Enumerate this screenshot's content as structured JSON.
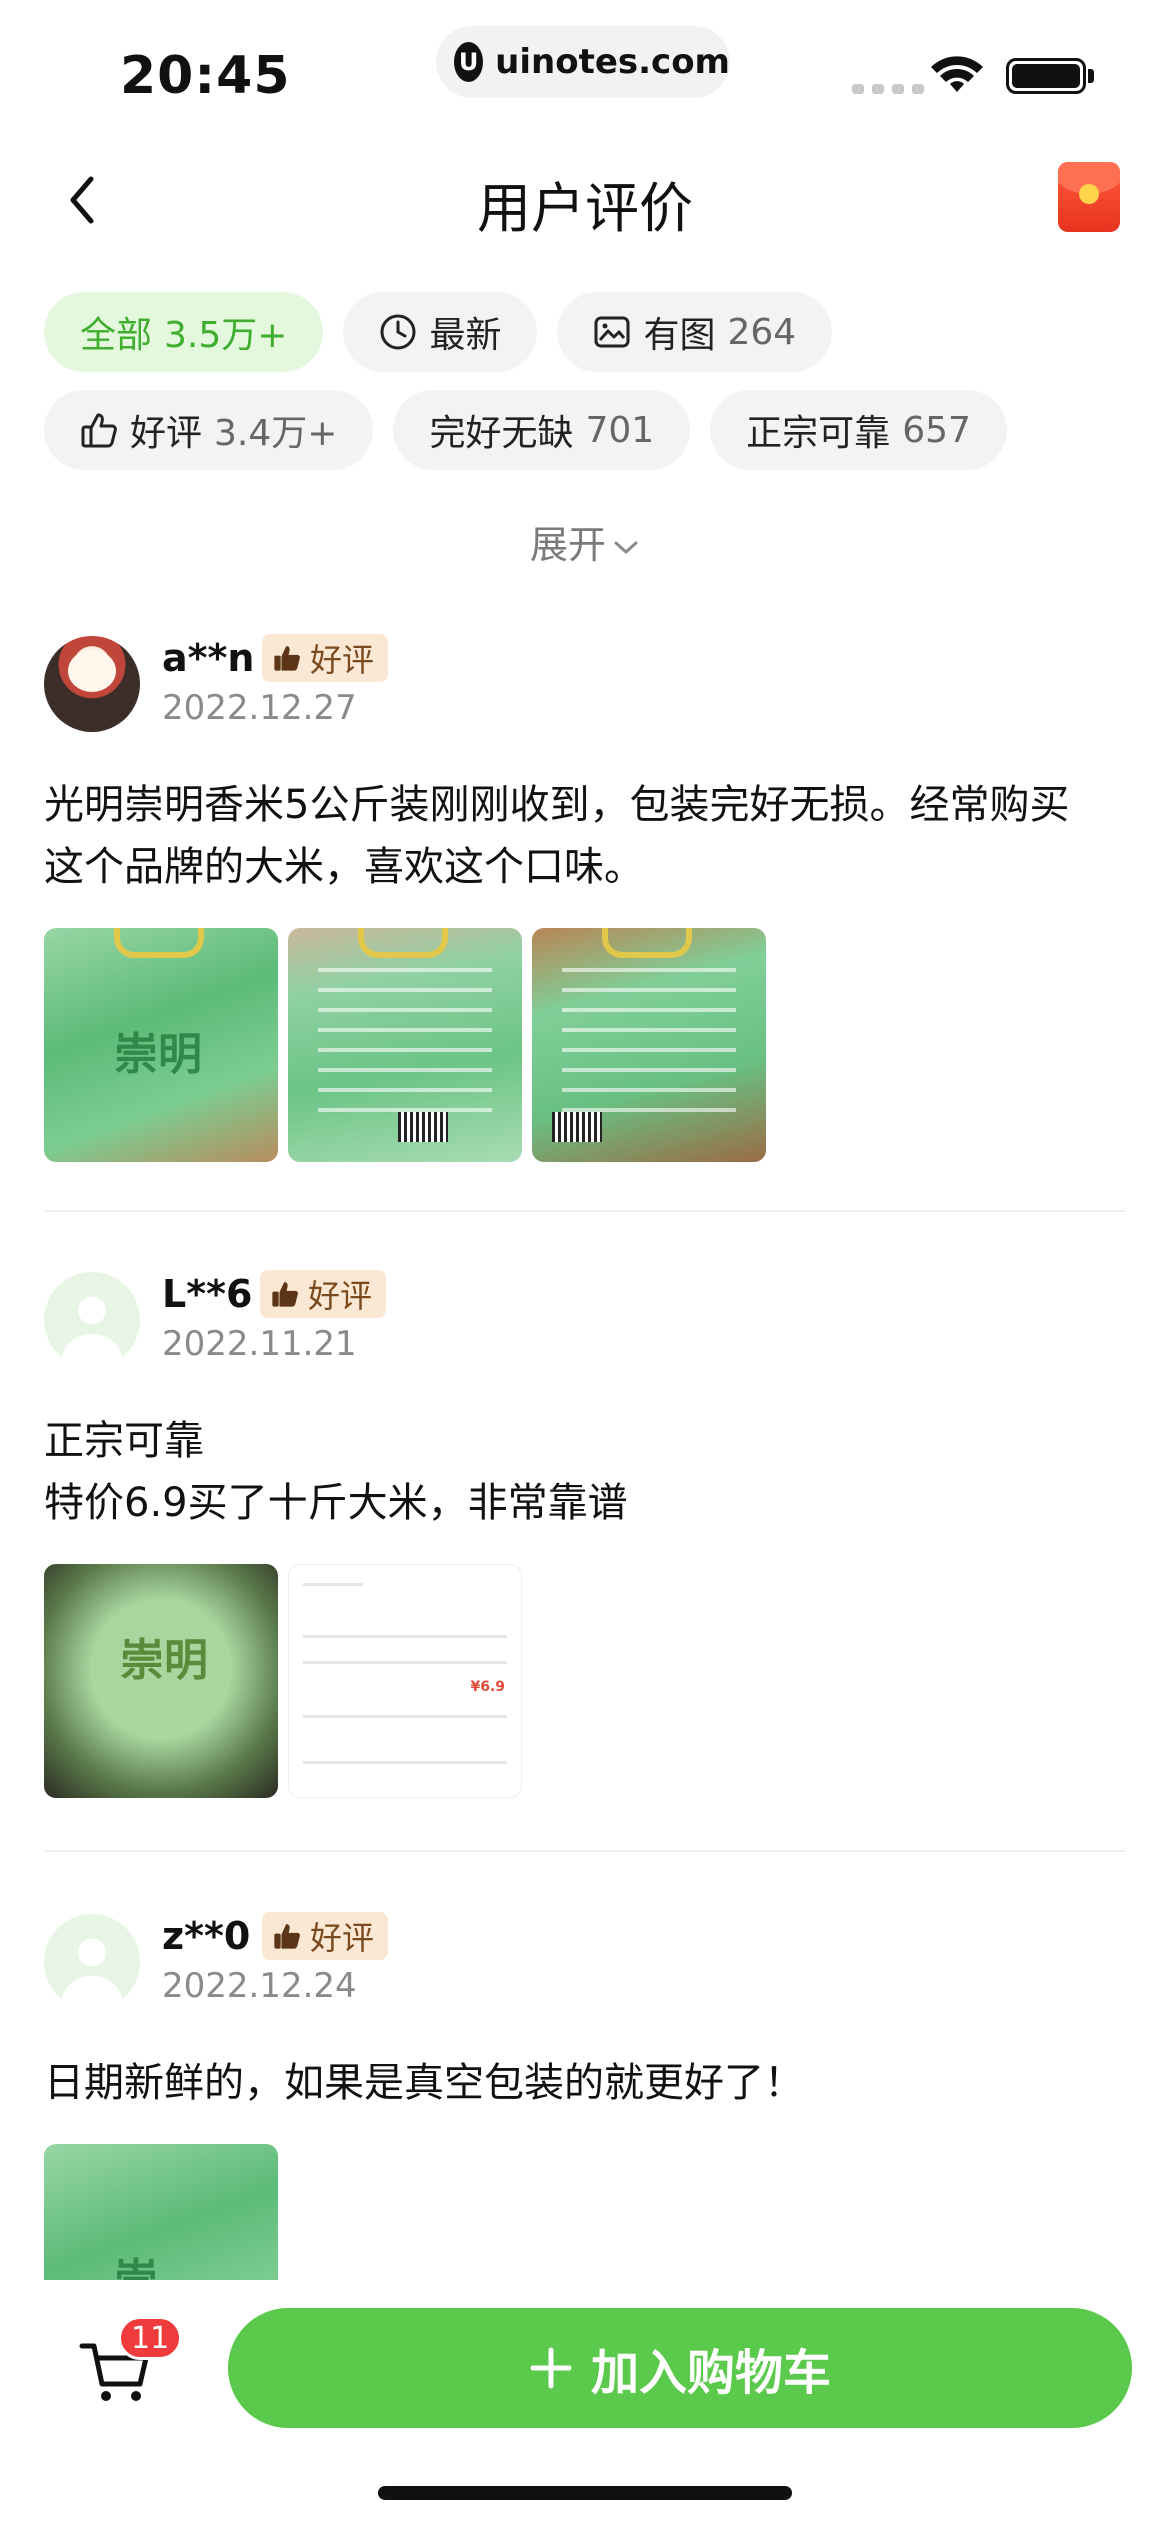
{
  "status_bar": {
    "time": "20:45",
    "url": "uinotes.com"
  },
  "nav": {
    "title": "用户评价"
  },
  "filters": {
    "row1": [
      {
        "label": "全部",
        "count": "3.5万+",
        "icon": "",
        "active": true
      },
      {
        "label": "最新",
        "count": "",
        "icon": "clock-icon",
        "active": false
      },
      {
        "label": "有图",
        "count": "264",
        "icon": "image-icon",
        "active": false
      }
    ],
    "row2": [
      {
        "label": "好评",
        "count": "3.4万+",
        "icon": "thumbs-up-icon",
        "active": false
      },
      {
        "label": "完好无缺",
        "count": "701",
        "icon": "",
        "active": false
      },
      {
        "label": "正宗可靠",
        "count": "657",
        "icon": "",
        "active": false
      }
    ],
    "expand_label": "展开"
  },
  "reviews": [
    {
      "user": "a**n",
      "badge": "好评",
      "date": "2022.12.27",
      "text_lines": [
        "光明崇明香米5公斤装刚刚收到，包装完好无损。经常购买",
        "这个品牌的大米，喜欢这个口味。"
      ],
      "photo_label": "崇明"
    },
    {
      "user": "L**6",
      "badge": "好评",
      "date": "2022.11.21",
      "text_lines": [
        "正宗可靠",
        "特价6.9买了十斤大米，非常靠谱"
      ],
      "photo_label": "崇明",
      "receipt_amount": "¥6.9"
    },
    {
      "user": "z**0",
      "badge": "好评",
      "date": "2022.12.24",
      "text_lines": [
        "日期新鲜的，如果是真空包装的就更好了！"
      ],
      "photo_label": "崇"
    }
  ],
  "bottom_bar": {
    "cart_count": "11",
    "add_to_cart_label": "加入购物车",
    "accent_color": "#5bc94b"
  },
  "colors": {
    "active_chip_bg": "#e4f8de",
    "active_chip_text": "#3fae2e",
    "badge_bg": "#fbe8d4",
    "cart_badge": "#ef3b3b"
  }
}
